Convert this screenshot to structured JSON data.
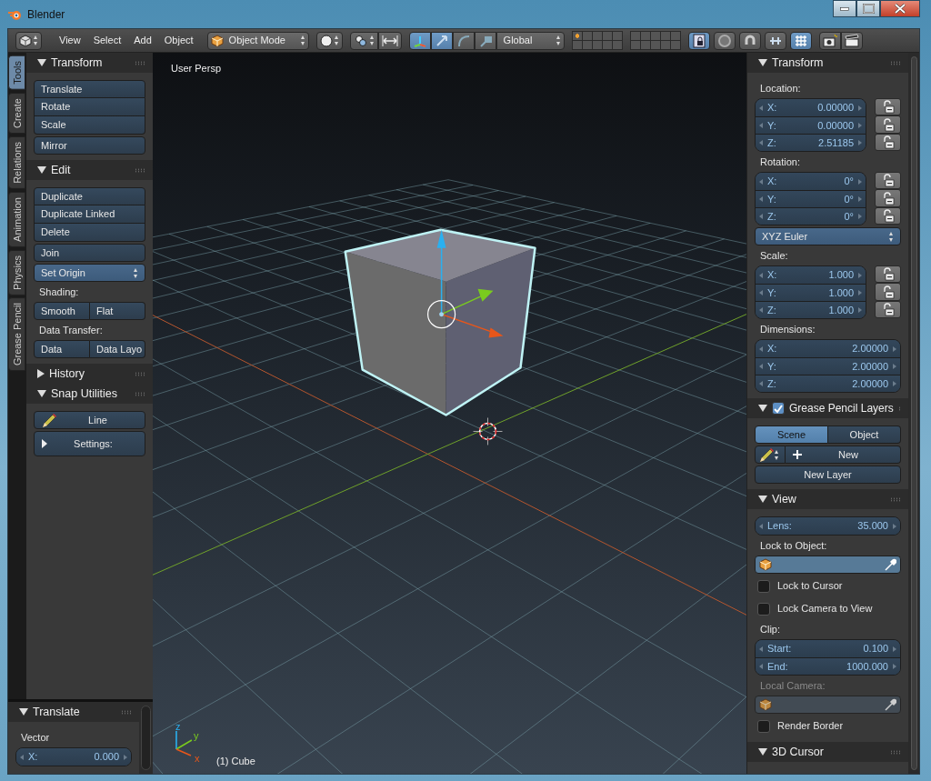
{
  "window": {
    "title": "Blender"
  },
  "header": {
    "menus": [
      "View",
      "Select",
      "Add",
      "Object"
    ],
    "mode": "Object Mode",
    "orientation": "Global",
    "manipulators": [
      {
        "selected": true
      },
      {
        "selected": true
      },
      {
        "selected": false
      },
      {
        "selected": false
      }
    ],
    "toggles": [
      {
        "selected": true
      },
      {
        "selected": false
      },
      {
        "selected": false
      },
      {
        "selected": false
      },
      {
        "selected": true
      }
    ]
  },
  "tool_tabs": [
    {
      "label": "Tools",
      "selected": true
    },
    {
      "label": "Create",
      "selected": false
    },
    {
      "label": "Relations",
      "selected": false
    },
    {
      "label": "Animation",
      "selected": false
    },
    {
      "label": "Physics",
      "selected": false
    },
    {
      "label": "Grease Pencil",
      "selected": false
    }
  ],
  "tool_panels": [
    {
      "title": "Transform",
      "expanded": true,
      "items": [
        {
          "kind": "stack",
          "buttons": [
            "Translate",
            "Rotate",
            "Scale"
          ]
        },
        {
          "kind": "stack",
          "buttons": [
            "Mirror"
          ]
        }
      ]
    },
    {
      "title": "Edit",
      "expanded": true,
      "items": [
        {
          "kind": "stack",
          "buttons": [
            "Duplicate",
            "Duplicate Linked",
            "Delete"
          ]
        },
        {
          "kind": "stack",
          "buttons": [
            "Join"
          ]
        },
        {
          "kind": "dropdown",
          "text": "Set Origin"
        },
        {
          "kind": "label",
          "text": "Shading:"
        },
        {
          "kind": "row",
          "buttons": [
            "Smooth",
            "Flat"
          ]
        },
        {
          "kind": "label",
          "text": "Data Transfer:"
        },
        {
          "kind": "row",
          "buttons": [
            "Data",
            "Data Layo"
          ]
        }
      ]
    },
    {
      "title": "History",
      "expanded": false
    },
    {
      "title": "Snap Utilities",
      "expanded": true,
      "items": [
        {
          "kind": "pencil_button",
          "text": "Line"
        },
        {
          "kind": "disclosure",
          "text": "Settings:"
        }
      ]
    }
  ],
  "operator_panel": {
    "title": "Translate",
    "expanded": true,
    "items": [
      {
        "kind": "label",
        "text": "Vector"
      },
      {
        "kind": "vector",
        "fields": [
          {
            "axis": "X:",
            "value": "0.000"
          }
        ]
      }
    ]
  },
  "viewport": {
    "view_name": "User Persp",
    "object_label": "(1) Cube",
    "axis_labels": [
      "z",
      "y",
      "x"
    ]
  },
  "properties_panels": [
    {
      "title": "Transform",
      "expanded": true,
      "items": [
        {
          "kind": "label",
          "text": "Location:"
        },
        {
          "kind": "vector",
          "fields": [
            {
              "axis": "X:",
              "value": "0.00000",
              "locked": false
            },
            {
              "axis": "Y:",
              "value": "0.00000",
              "locked": false
            },
            {
              "axis": "Z:",
              "value": "2.51185",
              "locked": false
            }
          ]
        },
        {
          "kind": "label",
          "text": "Rotation:"
        },
        {
          "kind": "vector",
          "fields": [
            {
              "axis": "X:",
              "value": "0°",
              "locked": false
            },
            {
              "axis": "Y:",
              "value": "0°",
              "locked": false
            },
            {
              "axis": "Z:",
              "value": "0°",
              "locked": false
            }
          ]
        },
        {
          "kind": "dropdown",
          "text": "XYZ Euler"
        },
        {
          "kind": "label",
          "text": "Scale:"
        },
        {
          "kind": "vector",
          "fields": [
            {
              "axis": "X:",
              "value": "1.000",
              "locked": false
            },
            {
              "axis": "Y:",
              "value": "1.000",
              "locked": false
            },
            {
              "axis": "Z:",
              "value": "1.000",
              "locked": false
            }
          ]
        },
        {
          "kind": "label",
          "text": "Dimensions:"
        },
        {
          "kind": "vector",
          "fields": [
            {
              "axis": "X:",
              "value": "2.00000"
            },
            {
              "axis": "Y:",
              "value": "2.00000"
            },
            {
              "axis": "Z:",
              "value": "2.00000"
            }
          ]
        }
      ]
    },
    {
      "title": "Grease Pencil Layers",
      "expanded": true,
      "checked": true,
      "items": [
        {
          "kind": "segmented",
          "options": [
            {
              "label": "Scene",
              "selected": true
            },
            {
              "label": "Object",
              "selected": false
            }
          ]
        },
        {
          "kind": "pencil_new",
          "text": "New"
        },
        {
          "kind": "button",
          "text": "New Layer"
        }
      ]
    },
    {
      "title": "View",
      "expanded": true,
      "items": [
        {
          "kind": "vector",
          "fields": [
            {
              "axis": "Lens:",
              "value": "35.000"
            }
          ]
        },
        {
          "kind": "label",
          "text": "Lock to Object:"
        },
        {
          "kind": "object_field",
          "disabled": false
        },
        {
          "kind": "checkbox",
          "text": "Lock to Cursor",
          "checked": false
        },
        {
          "kind": "checkbox",
          "text": "Lock Camera to View",
          "checked": false
        },
        {
          "kind": "label",
          "text": "Clip:"
        },
        {
          "kind": "vector",
          "fields": [
            {
              "axis": "Start:",
              "value": "0.100"
            },
            {
              "axis": "End:",
              "value": "1000.000"
            }
          ]
        },
        {
          "kind": "label",
          "text": "Local Camera:",
          "disabled": true
        },
        {
          "kind": "object_field",
          "disabled": true
        },
        {
          "kind": "checkbox",
          "text": "Render Border",
          "checked": false
        }
      ]
    },
    {
      "title": "3D Cursor",
      "expanded": true
    }
  ]
}
